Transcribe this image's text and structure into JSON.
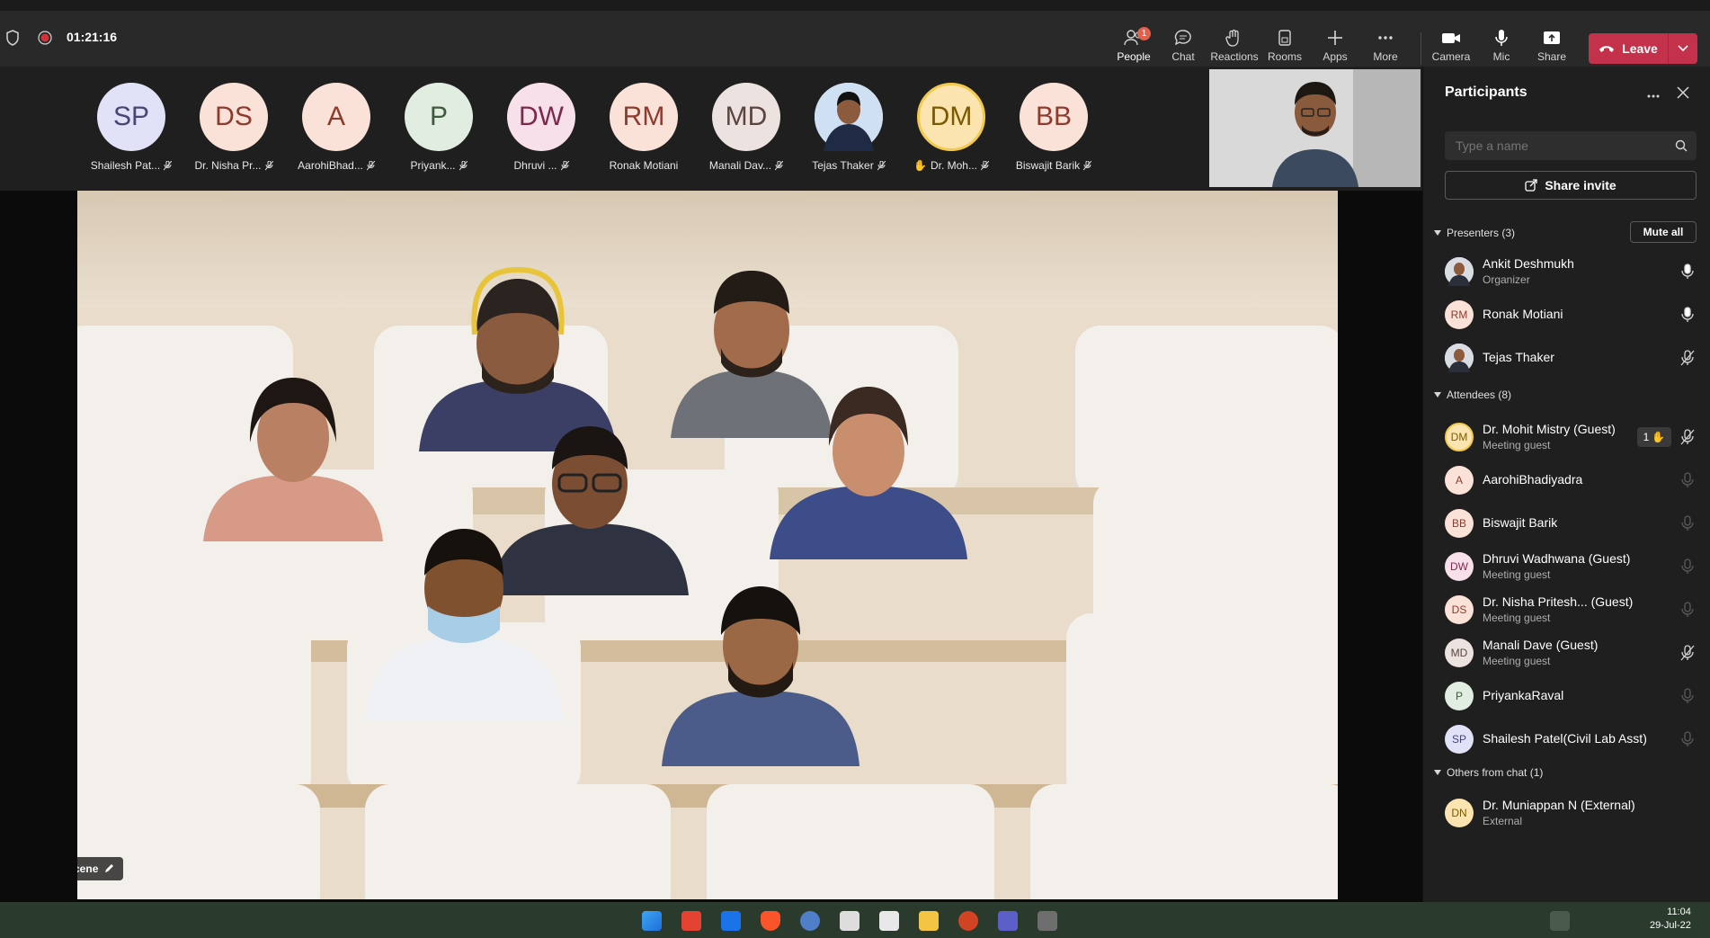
{
  "meeting": {
    "timer": "01:21:16"
  },
  "toolbar": {
    "people": {
      "label": "People",
      "badge": "1"
    },
    "chat": "Chat",
    "reactions": "Reactions",
    "rooms": "Rooms",
    "apps": "Apps",
    "more": "More",
    "camera": "Camera",
    "mic": "Mic",
    "share": "Share",
    "leave": "Leave"
  },
  "strip": [
    {
      "initials": "SP",
      "name": "Shailesh Pat...",
      "bg": "#e1e1f7",
      "fg": "#464775"
    },
    {
      "initials": "DS",
      "name": "Dr. Nisha Pr...",
      "bg": "#fbe2d9",
      "fg": "#8c3b2c"
    },
    {
      "initials": "A",
      "name": "AarohiBhad...",
      "bg": "#fbe2d9",
      "fg": "#8c3b2c"
    },
    {
      "initials": "P",
      "name": "Priyank...",
      "bg": "#e2ede2",
      "fg": "#3f5a3f"
    },
    {
      "initials": "DW",
      "name": "Dhruvi ...",
      "bg": "#f7e0ea",
      "fg": "#7c2a4c"
    },
    {
      "initials": "RM",
      "name": "Ronak Motiani",
      "bg": "#fbe2d9",
      "fg": "#8c3b2c"
    },
    {
      "initials": "MD",
      "name": "Manali Dav...",
      "bg": "#ece2df",
      "fg": "#5c4540"
    },
    {
      "initials": "",
      "name": "Tejas Thaker",
      "bg": "#dfe7f2",
      "fg": "#333"
    },
    {
      "initials": "DM",
      "name": "Dr. Moh...",
      "bg": "#fce4b0",
      "fg": "#7a5a00"
    },
    {
      "initials": "BB",
      "name": "Biswajit Barik",
      "bg": "#fbe2d9",
      "fg": "#8c3b2c"
    }
  ],
  "stage": {
    "change_scene": "Change scene"
  },
  "panel": {
    "title": "Participants",
    "search_placeholder": "Type a name",
    "share_invite": "Share invite",
    "mute_all": "Mute all",
    "presenters_label": "Presenters (3)",
    "attendees_label": "Attendees (8)",
    "others_label": "Others from chat (1)",
    "presenters": [
      {
        "initials": "",
        "name": "Ankit Deshmukh",
        "sub": "Organizer",
        "bg": "#cfcfcf",
        "fg": "#333"
      },
      {
        "initials": "RM",
        "name": "Ronak Motiani",
        "sub": "",
        "bg": "#fbe2d9",
        "fg": "#8c3b2c"
      },
      {
        "initials": "",
        "name": "Tejas Thaker",
        "sub": "",
        "bg": "#dfe7f2",
        "fg": "#333"
      }
    ],
    "attendees": [
      {
        "initials": "DM",
        "name": "Dr. Mohit Mistry (Guest)",
        "sub": "Meeting guest",
        "bg": "#fce4b0",
        "fg": "#7a5a00"
      },
      {
        "initials": "A",
        "name": "AarohiBhadiyadra",
        "sub": "",
        "bg": "#fbe2d9",
        "fg": "#8c3b2c"
      },
      {
        "initials": "BB",
        "name": "Biswajit Barik",
        "sub": "",
        "bg": "#fbe2d9",
        "fg": "#8c3b2c"
      },
      {
        "initials": "DW",
        "name": "Dhruvi Wadhwana (Guest)",
        "sub": "Meeting guest",
        "bg": "#f7e0ea",
        "fg": "#7c2a4c"
      },
      {
        "initials": "DS",
        "name": "Dr. Nisha Pritesh... (Guest)",
        "sub": "Meeting guest",
        "bg": "#fbe2d9",
        "fg": "#8c3b2c"
      },
      {
        "initials": "MD",
        "name": "Manali Dave (Guest)",
        "sub": "Meeting guest",
        "bg": "#ece2df",
        "fg": "#5c4540"
      },
      {
        "initials": "P",
        "name": "PriyankaRaval",
        "sub": "",
        "bg": "#e2ede2",
        "fg": "#3f5a3f"
      },
      {
        "initials": "SP",
        "name": "Shailesh Patel(Civil Lab Asst)",
        "sub": "",
        "bg": "#e1e1f7",
        "fg": "#464775"
      }
    ],
    "raised_hand_count": "1",
    "others": [
      {
        "initials": "DN",
        "name": "Dr. Muniappan N (External)",
        "sub": "External",
        "bg": "#fce4b0",
        "fg": "#7a5a00"
      }
    ]
  },
  "taskbar": {
    "time": "11:04",
    "date": "29-Jul-22"
  },
  "colors": {
    "accent": "#7f85f5",
    "leave": "#c4314b",
    "badge": "#e0614d"
  }
}
